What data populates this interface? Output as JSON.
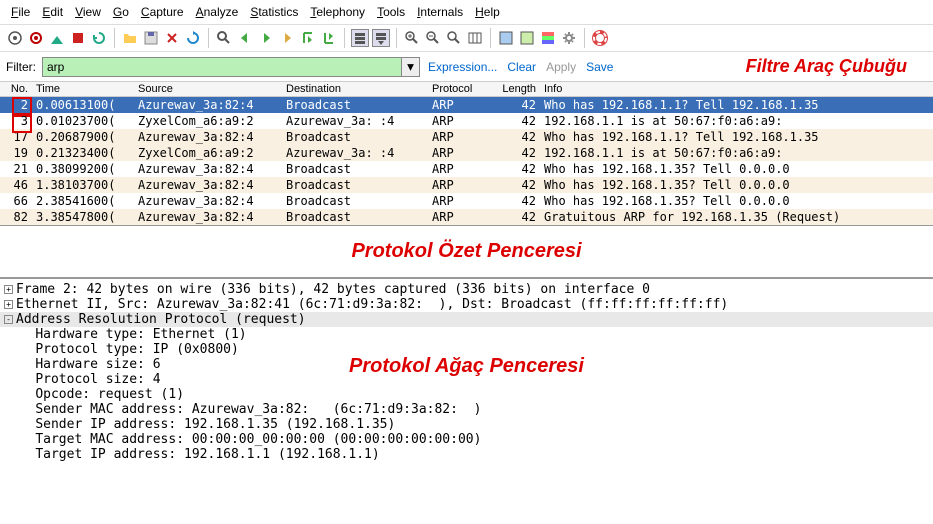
{
  "menu": [
    "File",
    "Edit",
    "View",
    "Go",
    "Capture",
    "Analyze",
    "Statistics",
    "Telephony",
    "Tools",
    "Internals",
    "Help"
  ],
  "filter": {
    "label": "Filter:",
    "value": "arp"
  },
  "filter_buttons": [
    "Expression...",
    "Clear",
    "Apply",
    "Save"
  ],
  "filter_label": "Filtre Araç Çubuğu",
  "headers": {
    "no": "No.",
    "time": "Time",
    "source": "Source",
    "dest": "Destination",
    "proto": "Protocol",
    "len": "Length",
    "info": "Info"
  },
  "packets": [
    {
      "no": "2",
      "time": "0.00613100(",
      "src": "Azurewav_3a:82:4",
      "dst": "Broadcast",
      "proto": "ARP",
      "len": "42",
      "info": "Who has 192.168.1.1?  Tell 192.168.1.35",
      "sel": true,
      "mark": true
    },
    {
      "no": "3",
      "time": "0.01023700(",
      "src": "ZyxelCom_a6:a9:2",
      "dst": "Azurewav_3a:  :4",
      "proto": "ARP",
      "len": "42",
      "info": "192.168.1.1 is at 50:67:f0:a6:a9:",
      "mark": true
    },
    {
      "no": "17",
      "time": "0.20687900(",
      "src": "Azurewav_3a:82:4",
      "dst": "Broadcast",
      "proto": "ARP",
      "len": "42",
      "info": "Who has 192.168.1.1?  Tell 192.168.1.35",
      "alt": true
    },
    {
      "no": "19",
      "time": "0.21323400(",
      "src": "ZyxelCom_a6:a9:2",
      "dst": "Azurewav_3a:  :4",
      "proto": "ARP",
      "len": "42",
      "info": "192.168.1.1 is at 50:67:f0:a6:a9:",
      "alt": true
    },
    {
      "no": "21",
      "time": "0.38099200(",
      "src": "Azurewav_3a:82:4",
      "dst": "Broadcast",
      "proto": "ARP",
      "len": "42",
      "info": "Who has 192.168.1.35?  Tell 0.0.0.0"
    },
    {
      "no": "46",
      "time": "1.38103700(",
      "src": "Azurewav_3a:82:4",
      "dst": "Broadcast",
      "proto": "ARP",
      "len": "42",
      "info": "Who has 192.168.1.35?  Tell 0.0.0.0",
      "alt": true
    },
    {
      "no": "66",
      "time": "2.38541600(",
      "src": "Azurewav_3a:82:4",
      "dst": "Broadcast",
      "proto": "ARP",
      "len": "42",
      "info": "Who has 192.168.1.35?  Tell 0.0.0.0"
    },
    {
      "no": "82",
      "time": "3.38547800(",
      "src": "Azurewav_3a:82:4",
      "dst": "Broadcast",
      "proto": "ARP",
      "len": "42",
      "info": "Gratuitous ARP for 192.168.1.35 (Request)",
      "alt": true
    }
  ],
  "caption1": "Protokol Özet Penceresi",
  "tree": [
    {
      "exp": "+",
      "t": "Frame 2: 42 bytes on wire (336 bits), 42 bytes captured (336 bits) on interface 0"
    },
    {
      "exp": "+",
      "t": "Ethernet II, Src: Azurewav_3a:82:41 (6c:71:d9:3a:82:  ), Dst: Broadcast (ff:ff:ff:ff:ff:ff)"
    },
    {
      "exp": "-",
      "t": "Address Resolution Protocol (request)",
      "hl": true
    },
    {
      "i": 1,
      "t": "Hardware type: Ethernet (1)"
    },
    {
      "i": 1,
      "t": "Protocol type: IP (0x0800)"
    },
    {
      "i": 1,
      "t": "Hardware size: 6"
    },
    {
      "i": 1,
      "t": "Protocol size: 4"
    },
    {
      "i": 1,
      "t": "Opcode: request (1)"
    },
    {
      "i": 1,
      "t": "Sender MAC address: Azurewav_3a:82:   (6c:71:d9:3a:82:  )"
    },
    {
      "i": 1,
      "t": "Sender IP address: 192.168.1.35 (192.168.1.35)"
    },
    {
      "i": 1,
      "t": "Target MAC address: 00:00:00_00:00:00 (00:00:00:00:00:00)"
    },
    {
      "i": 1,
      "t": "Target IP address: 192.168.1.1 (192.168.1.1)"
    }
  ],
  "caption2": "Protokol Ağaç Penceresi"
}
